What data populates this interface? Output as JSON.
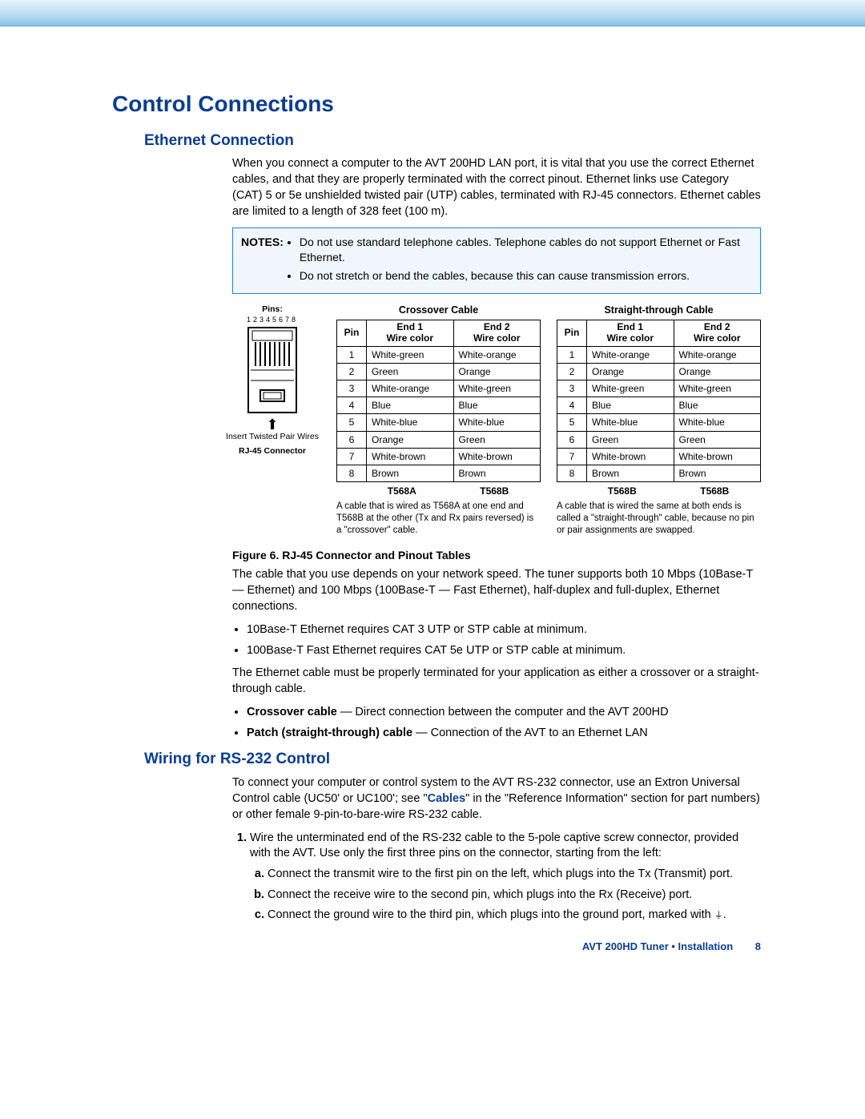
{
  "title": "Control Connections",
  "section1": {
    "title": "Ethernet Connection",
    "intro": "When you connect a computer to the AVT 200HD LAN port, it is vital that you use the correct Ethernet cables, and that they are properly terminated with the correct pinout. Ethernet links use Category (CAT) 5 or 5e unshielded twisted pair (UTP) cables, terminated with RJ-45 connectors. Ethernet cables are limited to a length of 328 feet (100 m)."
  },
  "notes": {
    "label": "NOTES:",
    "items": [
      "Do not use standard telephone cables. Telephone cables do not support Ethernet or Fast Ethernet.",
      "Do not stretch or bend the cables, because this can cause transmission errors."
    ]
  },
  "connector": {
    "pins_label": "Pins:",
    "pins_text": "12345678",
    "insert_text": "Insert Twisted Pair Wires",
    "name_label": "RJ-45 Connector"
  },
  "crossover": {
    "title": "Crossover Cable",
    "head_pin": "Pin",
    "head_end1": "End 1\nWire color",
    "head_end2": "End 2\nWire color",
    "rows": [
      {
        "p": "1",
        "a": "White-green",
        "b": "White-orange"
      },
      {
        "p": "2",
        "a": "Green",
        "b": "Orange"
      },
      {
        "p": "3",
        "a": "White-orange",
        "b": "White-green"
      },
      {
        "p": "4",
        "a": "Blue",
        "b": "Blue"
      },
      {
        "p": "5",
        "a": "White-blue",
        "b": "White-blue"
      },
      {
        "p": "6",
        "a": "Orange",
        "b": "Green"
      },
      {
        "p": "7",
        "a": "White-brown",
        "b": "White-brown"
      },
      {
        "p": "8",
        "a": "Brown",
        "b": "Brown"
      }
    ],
    "std1": "T568A",
    "std2": "T568B",
    "caption": "A cable that is wired as T568A at one end and T568B at the other (Tx and Rx pairs reversed) is a \"crossover\" cable."
  },
  "straight": {
    "title": "Straight-through Cable",
    "head_pin": "Pin",
    "head_end1": "End 1\nWire color",
    "head_end2": "End 2\nWire color",
    "rows": [
      {
        "p": "1",
        "a": "White-orange",
        "b": "White-orange"
      },
      {
        "p": "2",
        "a": "Orange",
        "b": "Orange"
      },
      {
        "p": "3",
        "a": "White-green",
        "b": "White-green"
      },
      {
        "p": "4",
        "a": "Blue",
        "b": "Blue"
      },
      {
        "p": "5",
        "a": "White-blue",
        "b": "White-blue"
      },
      {
        "p": "6",
        "a": "Green",
        "b": "Green"
      },
      {
        "p": "7",
        "a": "White-brown",
        "b": "White-brown"
      },
      {
        "p": "8",
        "a": "Brown",
        "b": "Brown"
      }
    ],
    "std1": "T568B",
    "std2": "T568B",
    "caption": "A cable that is wired the same at both ends is called a \"straight-through\" cable, because no pin or pair assignments are swapped."
  },
  "fig_caption": "Figure 6.   RJ-45 Connector and Pinout Tables",
  "after_fig": {
    "p1": "The cable that you use depends on your network speed. The tuner supports both 10 Mbps (10Base-T — Ethernet) and 100 Mbps (100Base-T — Fast Ethernet), half-duplex and full-duplex, Ethernet connections.",
    "b1": "10Base-T Ethernet requires CAT 3 UTP or STP cable at minimum.",
    "b2": "100Base-T Fast Ethernet requires CAT 5e UTP or STP cable at minimum.",
    "p2": "The Ethernet cable must be properly terminated for your application as either a crossover or a straight-through cable.",
    "b3_lead": "Crossover cable",
    "b3_rest": " — Direct connection between the computer and the AVT 200HD",
    "b4_lead": "Patch (straight-through) cable",
    "b4_rest": " — Connection of the AVT to an Ethernet LAN"
  },
  "section2": {
    "title": "Wiring for RS-232 Control",
    "intro_pre": "To connect your computer or control system to the AVT RS-232 connector, use an Extron Universal Control cable (UC50' or UC100'; see \"",
    "intro_link": "Cables",
    "intro_post": "\" in the \"Reference Information\" section for part numbers) or other female 9-pin-to-bare-wire RS-232 cable.",
    "step1": "Wire the unterminated end of the RS-232 cable to the 5-pole captive screw connector, provided with the AVT. Use only the first three pins on the connector, starting from the left:",
    "sub_a": "Connect the transmit wire to the first pin on the left, which plugs into the Tx (Transmit) port.",
    "sub_b": "Connect the receive wire to the second pin, which plugs into the Rx (Receive) port.",
    "sub_c_pre": "Connect the ground wire to the third pin, which plugs into the ground port, marked with ",
    "sub_c_post": "."
  },
  "footer": {
    "text": "AVT 200HD Tuner • Installation",
    "page": "8"
  }
}
